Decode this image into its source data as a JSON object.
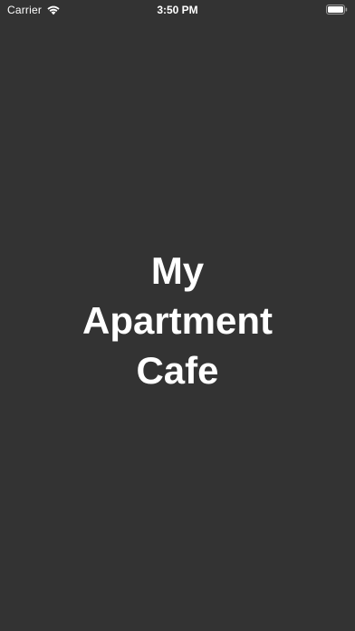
{
  "status_bar": {
    "carrier": "Carrier",
    "time": "3:50 PM",
    "wifi_icon": "wifi-icon",
    "battery_icon": "battery-icon"
  },
  "splash": {
    "title_lines": [
      "My",
      "Apartment",
      "Cafe"
    ]
  },
  "colors": {
    "background": "#333333",
    "text": "#ffffff"
  }
}
